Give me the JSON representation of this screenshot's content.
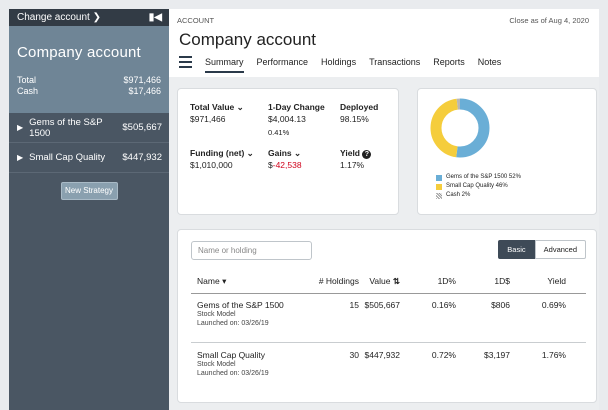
{
  "sidebar": {
    "header_label": "Change account",
    "chevron_icon": "chevron-down-icon",
    "collapse_icon": "collapse-left-icon",
    "account_title": "Company account",
    "total_label": "Total",
    "total_value": "$971,466",
    "cash_label": "Cash",
    "cash_value": "$17,466",
    "strategies": [
      {
        "name": "Gems of the S&P 1500",
        "value": "$505,667"
      },
      {
        "name": "Small Cap Quality",
        "value": "$447,932"
      }
    ],
    "new_strategy_label": "New Strategy"
  },
  "header": {
    "breadcrumb": "ACCOUNT",
    "close_as_of": "Close as of Aug 4, 2020",
    "title": "Company account"
  },
  "tabs": [
    "Summary",
    "Performance",
    "Holdings",
    "Transactions",
    "Reports",
    "Notes"
  ],
  "active_tab": "Summary",
  "stats": {
    "total_value_label": "Total Value",
    "total_value": "$971,466",
    "day_change_label": "1-Day Change",
    "day_change_value": "$4,004.13",
    "day_change_pct": "0.41%",
    "deployed_label": "Deployed",
    "deployed_value": "98.15%",
    "funding_label": "Funding (net)",
    "funding_value": "$1,010,000",
    "gains_label": "Gains",
    "gains_prefix": "$",
    "gains_value": "-42,538",
    "yield_label": "Yield",
    "yield_value": "1.17%"
  },
  "allocation": {
    "slices": [
      {
        "name": "Gems of the S&P 1500",
        "pct": 52,
        "color": "#6aaed6"
      },
      {
        "name": "Small Cap Quality",
        "pct": 46,
        "color": "#f5cd3c"
      },
      {
        "name": "Cash",
        "pct": 2,
        "color": "#b8b8b8"
      }
    ],
    "legend": [
      "Gems of the S&P 1500  52%",
      "Small Cap Quality  46%",
      "Cash  2%"
    ]
  },
  "table": {
    "search_placeholder": "Name or holding",
    "toggle_basic": "Basic",
    "toggle_advanced": "Advanced",
    "columns": [
      "Name",
      "# Holdings",
      "Value",
      "1D%",
      "1D$",
      "Yield"
    ],
    "rows": [
      {
        "name": "Gems of the S&P 1500",
        "type": "Stock Model",
        "launched": "Launched on: 03/26/19",
        "holdings": "15",
        "value": "$505,667",
        "d1pct": "0.16%",
        "d1usd": "$806",
        "yield": "0.69%"
      },
      {
        "name": "Small Cap Quality",
        "type": "Stock Model",
        "launched": "Launched on: 03/26/19",
        "holdings": "30",
        "value": "$447,932",
        "d1pct": "0.72%",
        "d1usd": "$3,197",
        "yield": "1.76%"
      }
    ]
  }
}
